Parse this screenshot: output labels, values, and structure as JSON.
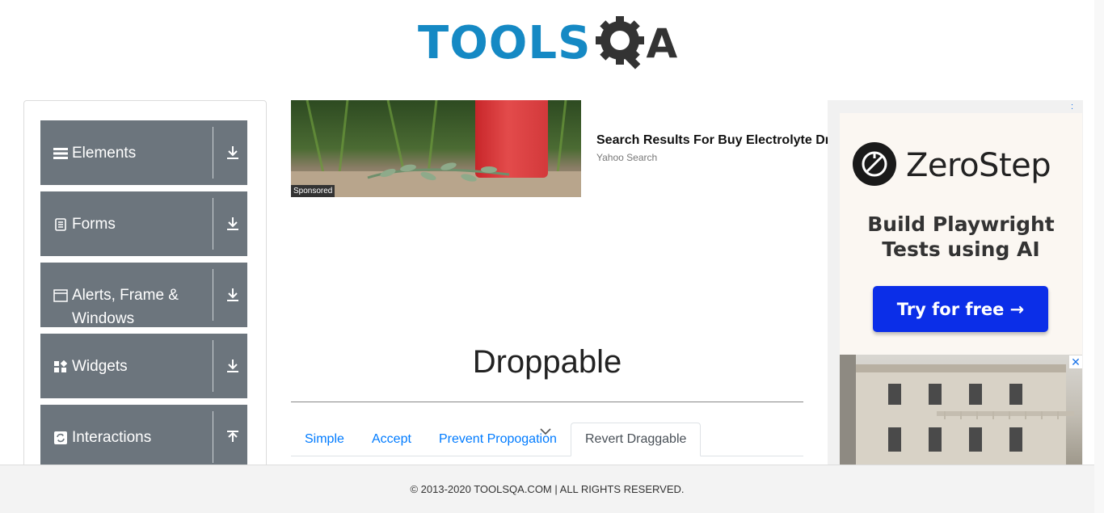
{
  "header": {
    "logo_text": "TOOLS",
    "logo_letter": "A"
  },
  "sidebar": {
    "groups": [
      {
        "label": "Elements",
        "icon": "hamburger-icon",
        "toggle": "download-arrow-icon"
      },
      {
        "label": "Forms",
        "icon": "document-icon",
        "toggle": "download-arrow-icon"
      },
      {
        "label": "Alerts, Frame & Windows",
        "icon": "window-icon",
        "toggle": "download-arrow-icon"
      },
      {
        "label": "Widgets",
        "icon": "widgets-icon",
        "toggle": "download-arrow-icon"
      },
      {
        "label": "Interactions",
        "icon": "refresh-icon",
        "toggle": "upload-arrow-icon"
      }
    ]
  },
  "ads": {
    "left": {
      "sponsored_label": "Sponsored",
      "title": "Search Results For Buy Electrolyte Dr",
      "source": "Yahoo Search"
    },
    "right": {
      "brand": "ZeroStep",
      "tagline": "Build Playwright Tests using AI",
      "cta": "Try for free →",
      "close_glyph": "✕",
      "menu_glyph": ":"
    }
  },
  "main": {
    "title": "Droppable",
    "tabs": [
      {
        "label": "Simple",
        "active": false
      },
      {
        "label": "Accept",
        "active": false
      },
      {
        "label": "Prevent Propogation",
        "active": false
      },
      {
        "label": "Revert Draggable",
        "active": true
      }
    ]
  },
  "footer": {
    "text": "© 2013-2020 TOOLSQA.COM | ALL RIGHTS RESERVED."
  },
  "colors": {
    "logo_blue": "#1589c4",
    "sidebar_group": "#6c757d",
    "link_blue": "#007bff",
    "cta_blue": "#0b2ee8"
  }
}
